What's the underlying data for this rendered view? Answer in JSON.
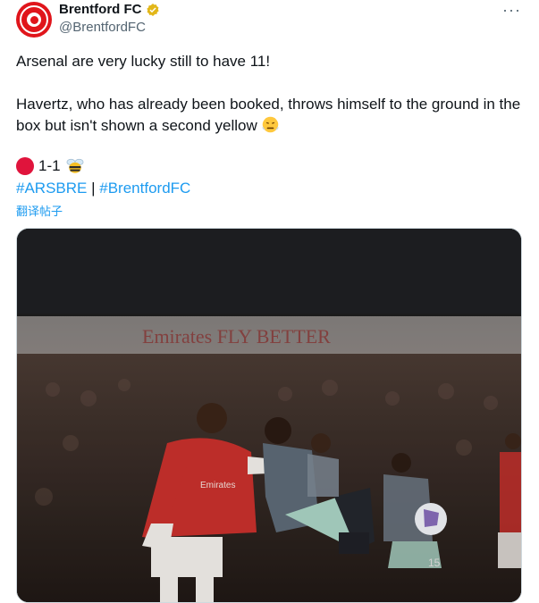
{
  "account": {
    "display_name": "Brentford FC",
    "handle": "@BrentfordFC",
    "verified": true
  },
  "more_menu": "···",
  "tweet": {
    "line1": "Arsenal are very lucky still to have 11!",
    "line2": "Havertz, who has already been booked, throws himself to the ground in the box but isn't shown a second yellow",
    "line2_emoji": "steaming-face-emoji",
    "score": "1-1",
    "score_left_icon": "red-circle-emoji",
    "score_right_icon": "bee-emoji",
    "hashtags": [
      "#ARSBRE",
      "#BrentfordFC"
    ],
    "hashtag_separator": "|",
    "translate_label": "翻译帖子"
  },
  "media": {
    "banner_text": "Emirates FLY BETTER",
    "shirt_text": "Emirates",
    "shirt_number": "15"
  },
  "colors": {
    "brand_red": "#e0151b",
    "link_blue": "#1d9bf0",
    "secondary_text": "#536471",
    "verified_gold": "#e2b719"
  }
}
